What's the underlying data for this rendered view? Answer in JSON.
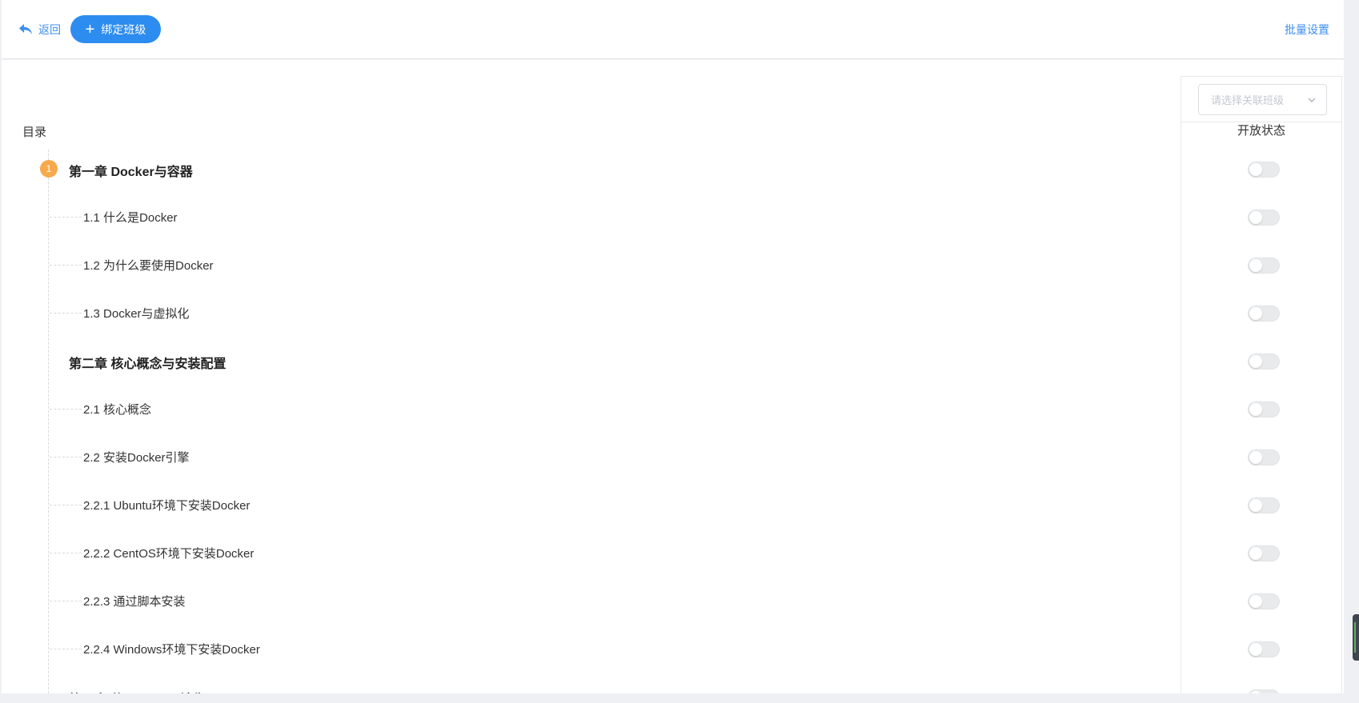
{
  "header": {
    "back_label": "返回",
    "bind_label": "绑定班级",
    "batch_label": "批量设置"
  },
  "class_select": {
    "placeholder": "请选择关联班级"
  },
  "toc": {
    "title": "目录",
    "status_title": "开放状态",
    "chapter1_badge": "1",
    "rows": [
      {
        "type": "chapter",
        "label": "第一章 Docker与容器",
        "open": false
      },
      {
        "type": "section",
        "label": "1.1 什么是Docker",
        "open": false
      },
      {
        "type": "section",
        "label": "1.2 为什么要使用Docker",
        "open": false
      },
      {
        "type": "section",
        "label": "1.3 Docker与虚拟化",
        "open": false
      },
      {
        "type": "chapter",
        "label": "第二章 核心概念与安装配置",
        "open": false
      },
      {
        "type": "section",
        "label": "2.1 核心概念",
        "open": false
      },
      {
        "type": "section",
        "label": "2.2 安装Docker引擎",
        "open": false
      },
      {
        "type": "section",
        "label": "2.2.1 Ubuntu环境下安装Docker",
        "open": false
      },
      {
        "type": "section",
        "label": "2.2.2 CentOS环境下安装Docker",
        "open": false
      },
      {
        "type": "section",
        "label": "2.2.3 通过脚本安装",
        "open": false
      },
      {
        "type": "section",
        "label": "2.2.4 Windows环境下安装Docker",
        "open": false
      },
      {
        "type": "chapter",
        "label": "第三章 使用Docker镜像",
        "open": false
      }
    ]
  },
  "colors": {
    "accent": "#2d8cf0",
    "link": "#3d8ef0",
    "badge": "#f7a94b"
  }
}
